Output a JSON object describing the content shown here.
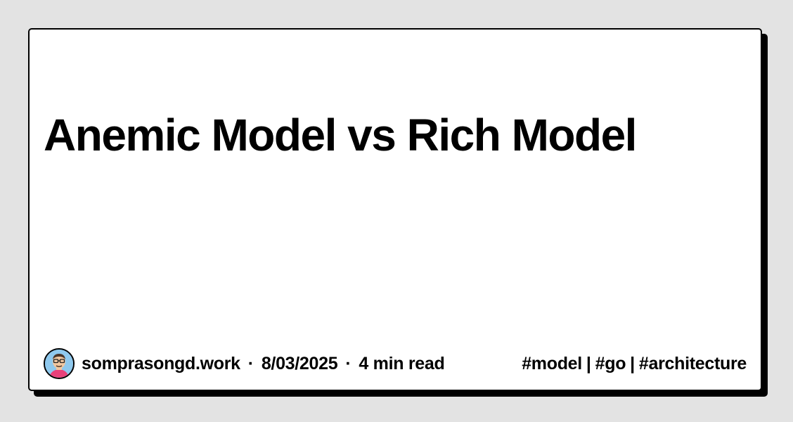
{
  "post": {
    "title": "Anemic Model vs Rich Model",
    "author": "somprasongd.work",
    "date": "8/03/2025",
    "read_time": "4 min read",
    "separator": "·"
  },
  "tags": {
    "items": [
      "#model",
      "#go",
      "#architecture"
    ],
    "divider": "|"
  },
  "colors": {
    "background": "#e3e3e3",
    "card": "#ffffff",
    "border": "#000000",
    "text": "#000000",
    "avatar_bg": "#8fc9ee"
  },
  "icons": {
    "avatar": "avatar-icon"
  }
}
